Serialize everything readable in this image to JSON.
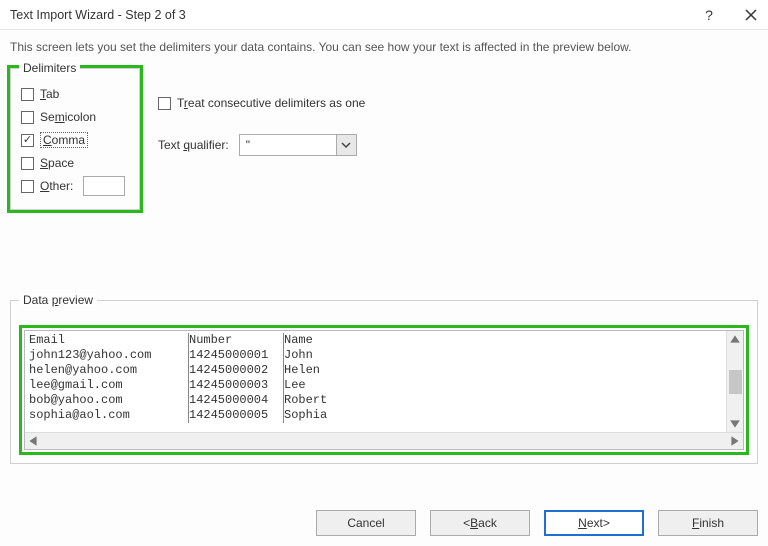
{
  "window": {
    "title": "Text Import Wizard - Step 2 of 3",
    "instruction": "This screen lets you set the delimiters your data contains.  You can see how your text is affected in the preview below."
  },
  "delimiters": {
    "legend": "Delimiters",
    "tab": "Tab",
    "semicolon": "Semicolon",
    "comma": "Comma",
    "space": "Space",
    "other": "Other:",
    "other_value": ""
  },
  "options": {
    "treat_consecutive": "Treat consecutive delimiters as one",
    "text_qualifier_label": "Text qualifier:",
    "text_qualifier_value": "\""
  },
  "preview": {
    "legend": "Data preview",
    "rows": [
      {
        "c0": "Email",
        "c1": "Number",
        "c2": "Name"
      },
      {
        "c0": "john123@yahoo.com",
        "c1": "14245000001",
        "c2": "John"
      },
      {
        "c0": "helen@yahoo.com",
        "c1": "14245000002",
        "c2": "Helen"
      },
      {
        "c0": "lee@gmail.com",
        "c1": "14245000003",
        "c2": "Lee"
      },
      {
        "c0": "bob@yahoo.com",
        "c1": "14245000004",
        "c2": "Robert"
      },
      {
        "c0": "sophia@aol.com",
        "c1": "14245000005",
        "c2": "Sophia"
      }
    ]
  },
  "buttons": {
    "cancel": "Cancel",
    "back": "< Back",
    "next": "Next >",
    "finish": "Finish"
  }
}
